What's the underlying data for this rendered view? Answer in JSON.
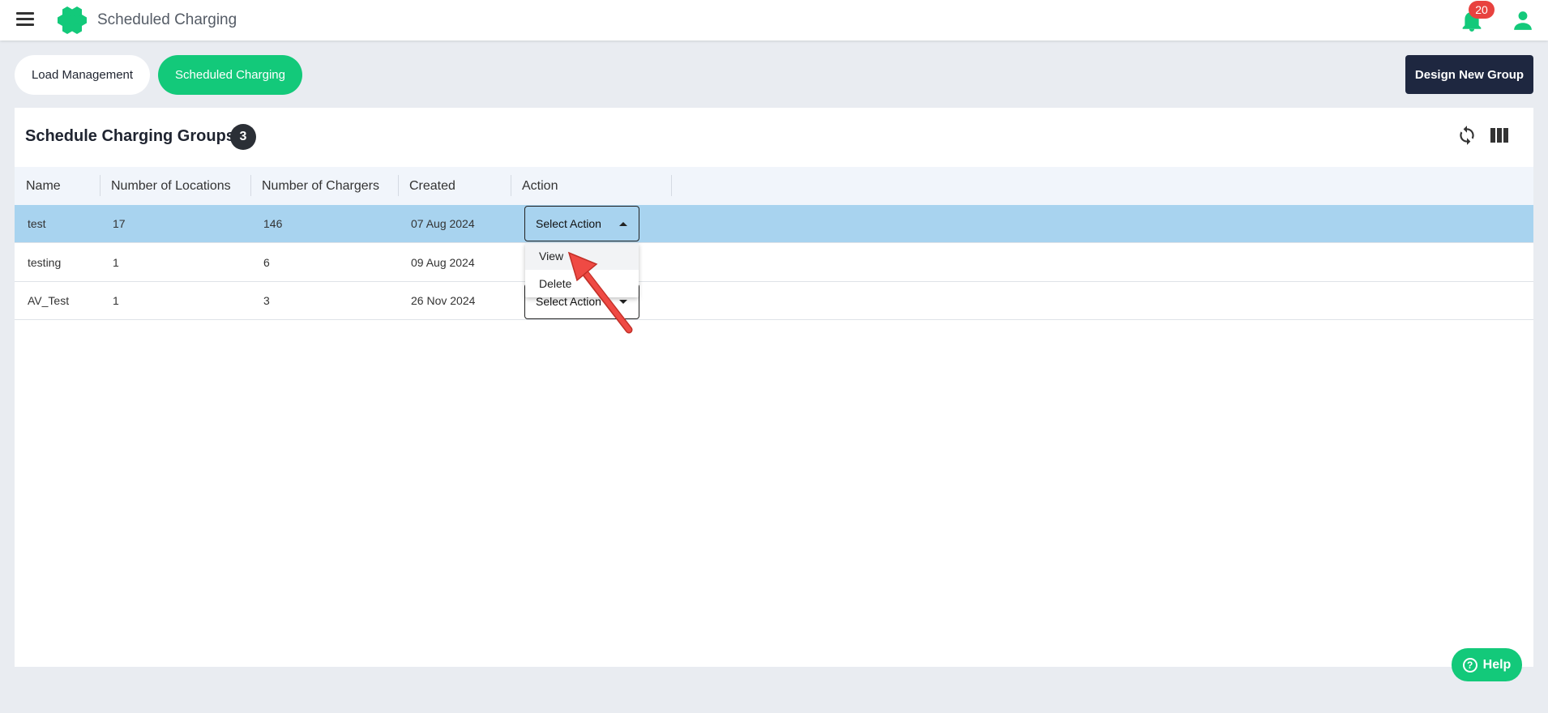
{
  "header": {
    "title": "Scheduled Charging",
    "notification_count": "20"
  },
  "tabs": [
    {
      "label": "Load Management",
      "active": false
    },
    {
      "label": "Scheduled Charging",
      "active": true
    }
  ],
  "toolbar": {
    "design_new_group_label": "Design New Group"
  },
  "panel": {
    "title": "Schedule Charging Groups",
    "count": "3"
  },
  "table": {
    "columns": [
      "Name",
      "Number of Locations",
      "Number of Chargers",
      "Created",
      "Action"
    ],
    "rows": [
      {
        "name": "test",
        "locations": "17",
        "chargers": "146",
        "created": "07 Aug 2024",
        "action": "Select Action"
      },
      {
        "name": "testing",
        "locations": "1",
        "chargers": "6",
        "created": "09 Aug 2024",
        "action": "Select Action"
      },
      {
        "name": "AV_Test",
        "locations": "1",
        "chargers": "3",
        "created": "26 Nov 2024",
        "action": "Select Action"
      }
    ]
  },
  "dropdown": {
    "options": [
      "View",
      "Delete"
    ]
  },
  "help": {
    "label": "Help"
  },
  "colors": {
    "accent": "#13c97a",
    "dark_button": "#1e2740",
    "selected_row": "#a8d3ef",
    "badge_red": "#e8423f",
    "annotation_arrow": "#e8423f"
  }
}
